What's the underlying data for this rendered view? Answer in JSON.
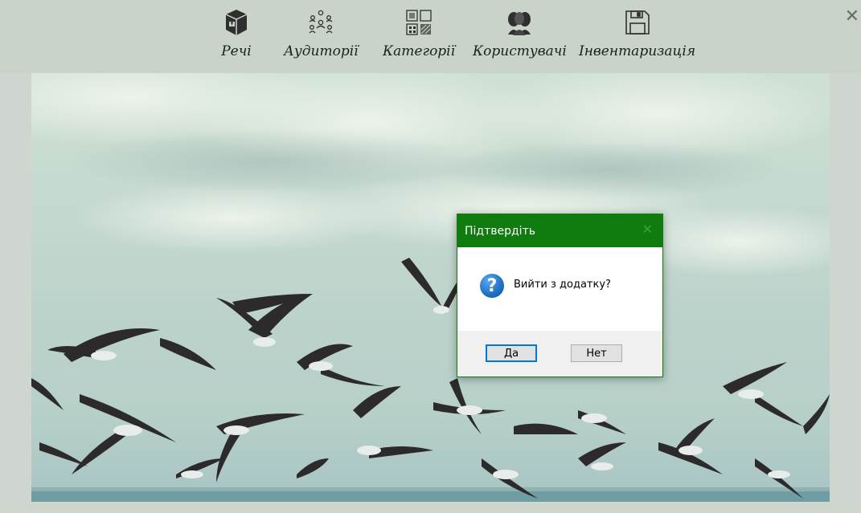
{
  "toolbar": {
    "items": [
      {
        "label": "Речі",
        "icon": "box-icon"
      },
      {
        "label": "Аудиторії",
        "icon": "people-network-icon"
      },
      {
        "label": "Категорії",
        "icon": "category-grid-icon"
      },
      {
        "label": "Користувачі",
        "icon": "users-icon"
      },
      {
        "label": "Інвентаризація",
        "icon": "save-icon"
      }
    ],
    "close_label": "✕"
  },
  "dialog": {
    "title": "Підтвердіть",
    "close_label": "✕",
    "message": "Вийти з додатку?",
    "icon": "question-icon",
    "buttons": {
      "yes": "Да",
      "no": "Нет"
    }
  },
  "colors": {
    "toolbar_bg": "#c9d3c9",
    "dialog_title_bg": "#107c10",
    "accent_focus": "#0078d7"
  }
}
